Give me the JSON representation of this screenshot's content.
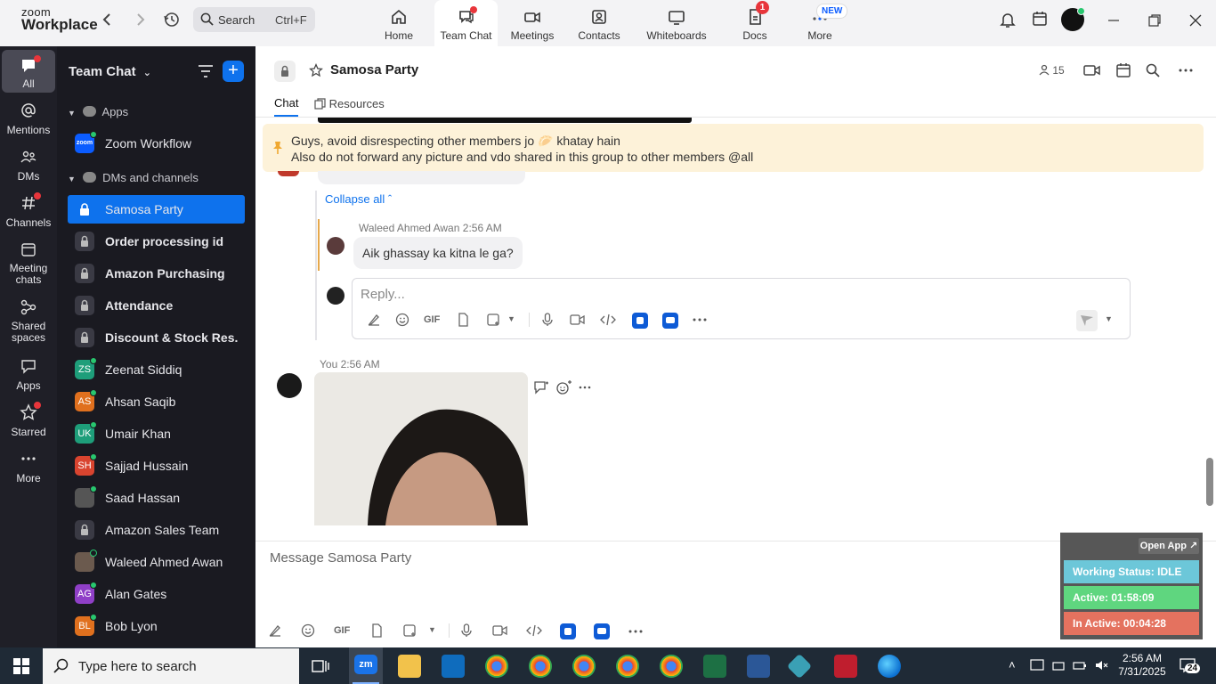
{
  "topbar": {
    "logo_line1": "zoom",
    "logo_line2": "Workplace",
    "search_label": "Search",
    "search_shortcut": "Ctrl+F",
    "tabs": [
      {
        "label": "Home"
      },
      {
        "label": "Team Chat"
      },
      {
        "label": "Meetings"
      },
      {
        "label": "Contacts"
      },
      {
        "label": "Whiteboards"
      },
      {
        "label": "Docs"
      },
      {
        "label": "More"
      }
    ],
    "docs_badge": "1",
    "more_badge": "NEW"
  },
  "rail": {
    "items": [
      {
        "label": "All"
      },
      {
        "label": "Mentions"
      },
      {
        "label": "DMs"
      },
      {
        "label": "Channels"
      },
      {
        "label": "Meeting chats"
      },
      {
        "label": "Shared spaces"
      },
      {
        "label": "Apps"
      },
      {
        "label": "Starred"
      },
      {
        "label": "More"
      }
    ]
  },
  "sidebar": {
    "title": "Team Chat",
    "apps_section": "Apps",
    "zoom_workflow": "Zoom Workflow",
    "zoom_workflow_icon_text": "zoom",
    "dms_section": "DMs and channels",
    "items": [
      {
        "name": "Samosa Party"
      },
      {
        "name": "Order processing id"
      },
      {
        "name": "Amazon Purchasing"
      },
      {
        "name": "Attendance"
      },
      {
        "name": "Discount & Stock Res..."
      },
      {
        "name": "Zeenat Siddiq",
        "initials": "ZS",
        "color": "#1e9e7a"
      },
      {
        "name": "Ahsan Saqib",
        "initials": "AS",
        "color": "#e0701e"
      },
      {
        "name": "Umair Khan",
        "initials": "UK",
        "color": "#1e9e7a"
      },
      {
        "name": "Sajjad Hussain",
        "initials": "SH",
        "color": "#d9442f"
      },
      {
        "name": "Saad Hassan"
      },
      {
        "name": "Amazon Sales Team"
      },
      {
        "name": "Waleed Ahmed Awan"
      },
      {
        "name": "Alan Gates",
        "initials": "AG",
        "color": "#8f3fc7"
      },
      {
        "name": "Bob Lyon",
        "initials": "BL",
        "color": "#e0701e"
      }
    ]
  },
  "main": {
    "channel_title": "Samosa Party",
    "member_count": "15",
    "tab_chat": "Chat",
    "tab_resources": "Resources",
    "pinned_line1": "Guys, avoid disrespecting other members jo 🥟 khatay hain",
    "pinned_line2": "Also do not forward any picture and vdo shared in this group to other members @all",
    "collapse_all": "Collapse all",
    "thread_author": "Waleed Ahmed Awan",
    "thread_time": "2:56 AM",
    "thread_message": "Aik ghassay ka kitna le ga?",
    "reply_placeholder": "Reply...",
    "you_label": "You",
    "you_time": "2:56 AM",
    "message_placeholder": "Message Samosa Party",
    "gif_label": "GIF"
  },
  "widget": {
    "open_app": "Open App ↗",
    "working_status": "Working Status: IDLE",
    "active": "Active: 01:58:09",
    "inactive": "In Active: 00:04:28"
  },
  "taskbar": {
    "search_placeholder": "Type here to search",
    "time": "2:56 AM",
    "date": "7/31/2025",
    "notif_count": "24",
    "zoom_icon_text": "zm"
  },
  "colors": {
    "accent": "#0e72ed",
    "sidebar_bg": "#1a1a21",
    "pinned_bg": "#fdf2d9",
    "status_idle": "#6cc7d9",
    "status_active": "#5fd67f",
    "status_inactive": "#e4725f"
  }
}
